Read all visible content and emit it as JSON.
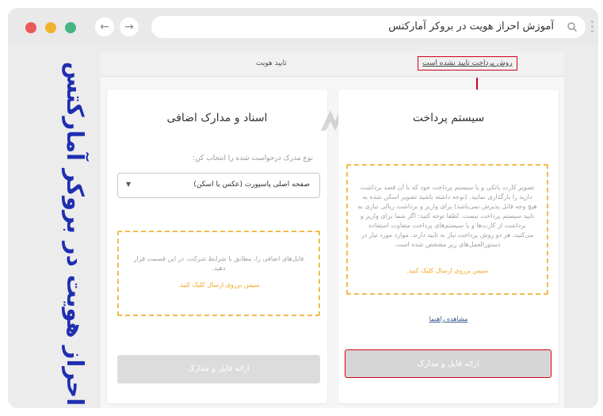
{
  "browser": {
    "address_text": "آموزش احراز هویت در بروکر آمارکتس"
  },
  "side_title": "احراز هویت در بروکر آمارکتس",
  "steps": {
    "verify_label": "تایید هویت",
    "payment_label": "روش پرداخت تایید نشده است"
  },
  "left_card": {
    "title": "اسناد و مدارک اضافی",
    "prompt": "نوع مدرک درخواست شده را انتخاب کن:",
    "select_value": "صفحه اصلی پاسپورت (عکس یا اسکن)",
    "dropzone_text": "فایل‌های اضافی را، مطابق با شرایط شرکت، در این قسمت قرار دهید.",
    "dropzone_link": "سپس برروی ارسال کلیک کنید.",
    "submit_label": "ارائه فایل و مدارک"
  },
  "right_card": {
    "title": "سیستم پرداخت",
    "dropzone_text": "تصویر کارت بانکی و یا سیستم پرداخت خود که با آن قصد برداشت دارید را بارگذاری نمایید. (توجه داشته باشید تصویر اسکن شده به هیچ وجه قابل پذیرش نمی‌باشد) برای واریز و برداشت ریالی نیازی به تایید سیستم پرداخت نیست. لطفا توجه کنید: اگر شما برای واریز و برداشت از کارت‌ها و یا سیستم‌های پرداخت متفاوت استفاده می‌کنید، هر دو روش پرداخت نیاز به تایید دارند. موارد مورد نیاز در دستورالعمل‌های زیر مشخص شده است.",
    "dropzone_link": "سپس برروی ارسال کلیک کنید.",
    "guide_link": "مشاهده راهنما",
    "submit_label": "ارائه فایل و مدارک"
  },
  "colors": {
    "accent_red": "#d0021b",
    "dropzone_border": "#f2bc4a",
    "side_title": "#1f2fb0"
  }
}
